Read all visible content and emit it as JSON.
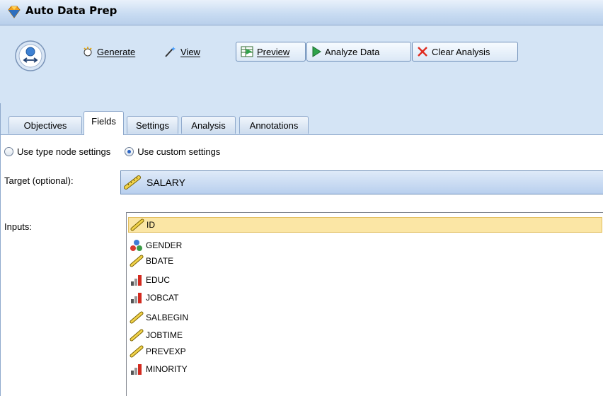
{
  "window": {
    "title": "Auto Data Prep",
    "icon": "gem-node-icon"
  },
  "toolbar": {
    "node_icon": "auto-data-prep-node-icon",
    "generate_label": "Generate",
    "view_label": "View",
    "preview_label": "Preview",
    "analyze_label": "Analyze Data",
    "clear_label": "Clear Analysis"
  },
  "tabs": [
    {
      "label": "Objectives",
      "active": false
    },
    {
      "label": "Fields",
      "active": true
    },
    {
      "label": "Settings",
      "active": false
    },
    {
      "label": "Analysis",
      "active": false
    },
    {
      "label": "Annotations",
      "active": false
    }
  ],
  "settings_mode": {
    "options": [
      {
        "label": "Use type node settings",
        "checked": false
      },
      {
        "label": "Use custom settings",
        "checked": true
      }
    ]
  },
  "target": {
    "label": "Target (optional):",
    "value": "SALARY",
    "icon": "continuous-ruler-icon"
  },
  "inputs": {
    "label": "Inputs:",
    "items": [
      {
        "name": "ID",
        "icon": "continuous-ruler-icon",
        "selected": true
      },
      {
        "name": "GENDER",
        "icon": "nominal-circles-icon",
        "selected": false
      },
      {
        "name": "BDATE",
        "icon": "continuous-ruler-icon",
        "selected": false
      },
      {
        "name": "EDUC",
        "icon": "ordinal-bars-icon",
        "selected": false
      },
      {
        "name": "JOBCAT",
        "icon": "ordinal-bars-icon",
        "selected": false
      },
      {
        "name": "SALBEGIN",
        "icon": "continuous-ruler-icon",
        "selected": false
      },
      {
        "name": "JOBTIME",
        "icon": "continuous-ruler-icon",
        "selected": false
      },
      {
        "name": "PREVEXP",
        "icon": "continuous-ruler-icon",
        "selected": false
      },
      {
        "name": "MINORITY",
        "icon": "ordinal-bars-icon",
        "selected": false
      }
    ]
  },
  "colors": {
    "accent": "#2b64c3",
    "selection": "#fbe6a5",
    "chrome": "#d4e4f5"
  }
}
